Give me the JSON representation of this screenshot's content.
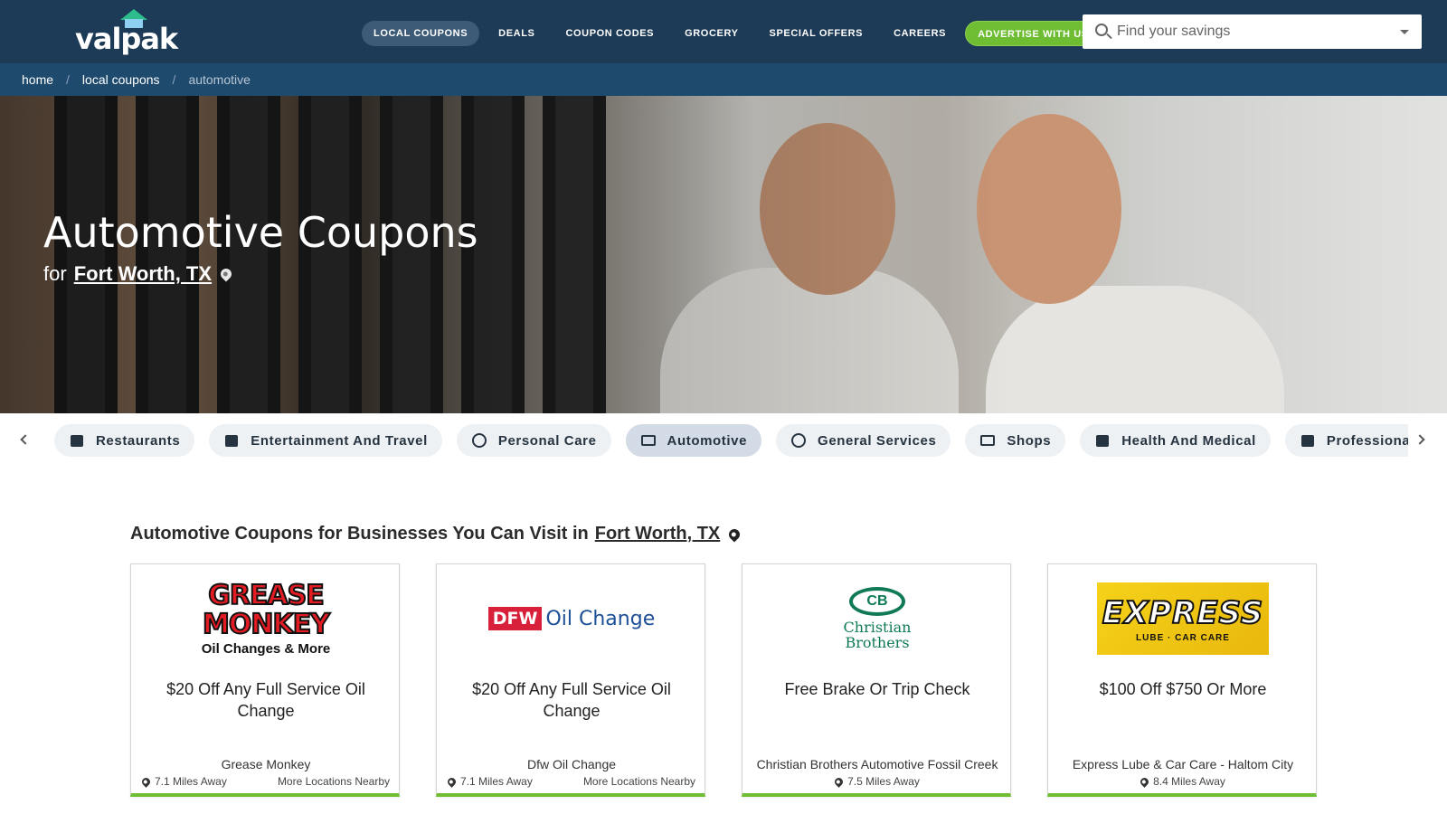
{
  "header": {
    "logo_text": "valpak",
    "nav": [
      {
        "label": "LOCAL COUPONS"
      },
      {
        "label": "DEALS"
      },
      {
        "label": "COUPON CODES"
      },
      {
        "label": "GROCERY"
      },
      {
        "label": "SPECIAL OFFERS"
      },
      {
        "label": "CAREERS"
      },
      {
        "label": "ADVERTISE WITH US"
      }
    ],
    "search": {
      "placeholder": "Find your savings",
      "value": ""
    }
  },
  "breadcrumb": [
    {
      "label": "home"
    },
    {
      "label": "local coupons"
    },
    {
      "label": "automotive"
    }
  ],
  "hero": {
    "title": "Automotive Coupons",
    "for_label": "for",
    "location": "Fort Worth, TX"
  },
  "categories": [
    {
      "label": "Restaurants",
      "icon": "restaurant-icon"
    },
    {
      "label": "Entertainment And Travel",
      "icon": "ticket-icon"
    },
    {
      "label": "Personal Care",
      "icon": "face-icon"
    },
    {
      "label": "Automotive",
      "icon": "car-icon",
      "active": true
    },
    {
      "label": "General Services",
      "icon": "services-icon"
    },
    {
      "label": "Shops",
      "icon": "store-icon"
    },
    {
      "label": "Health And Medical",
      "icon": "medical-icon"
    },
    {
      "label": "Professional Services",
      "icon": "gavel-icon"
    }
  ],
  "listings": {
    "heading": "Automotive Coupons for Businesses You Can Visit in",
    "location": "Fort Worth, TX",
    "cards": [
      {
        "logo": {
          "line1": "GREASE",
          "line2": "MONKEY",
          "tagline": "Oil Changes & More"
        },
        "offer": "$20 Off Any Full Service Oil Change",
        "business": "Grease Monkey",
        "distance": "7.1 Miles Away",
        "more": "More Locations Nearby"
      },
      {
        "logo": {
          "badge": "DFW",
          "text": "Oil Change"
        },
        "offer": "$20 Off Any Full Service Oil Change",
        "business": "Dfw Oil Change",
        "distance": "7.1 Miles Away",
        "more": "More Locations Nearby"
      },
      {
        "logo": {
          "mark": "CB",
          "line1": "Christian",
          "line2": "Brothers"
        },
        "offer": "Free Brake Or Trip Check",
        "business": "Christian Brothers Automotive Fossil Creek",
        "distance": "7.5 Miles Away"
      },
      {
        "logo": {
          "word": "EXPRESS",
          "tagline": "LUBE · CAR CARE"
        },
        "offer": "$100 Off $750 Or More",
        "business": "Express Lube & Car Care - Haltom City",
        "distance": "8.4 Miles Away"
      }
    ]
  },
  "colors": {
    "header_bg": "#1d3a56",
    "breadcrumb_bg": "#1e4a6e",
    "accent_green": "#6ebd32",
    "chip_bg": "#eef1f4",
    "chip_active_bg": "#d3dbe6"
  }
}
